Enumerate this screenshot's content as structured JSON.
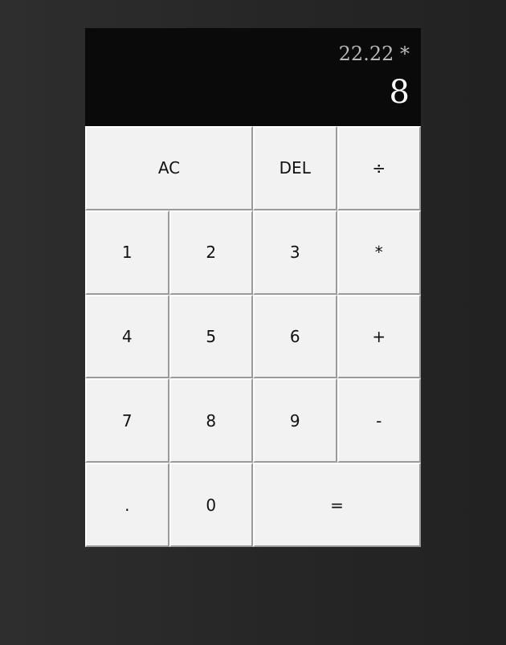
{
  "display": {
    "previous_operand": "22.22 *",
    "current_operand": "8"
  },
  "keys": {
    "clear": "AC",
    "delete": "DEL",
    "divide": "÷",
    "one": "1",
    "two": "2",
    "three": "3",
    "multiply": "*",
    "four": "4",
    "five": "5",
    "six": "6",
    "add": "+",
    "seven": "7",
    "eight": "8",
    "nine": "9",
    "subtract": "-",
    "decimal": ".",
    "zero": "0",
    "equals": "="
  },
  "colors": {
    "display_bg": "#0a0a0a",
    "key_bg": "#f2f2f2",
    "previous_text": "#b9b9b9",
    "current_text": "#ffffff"
  }
}
